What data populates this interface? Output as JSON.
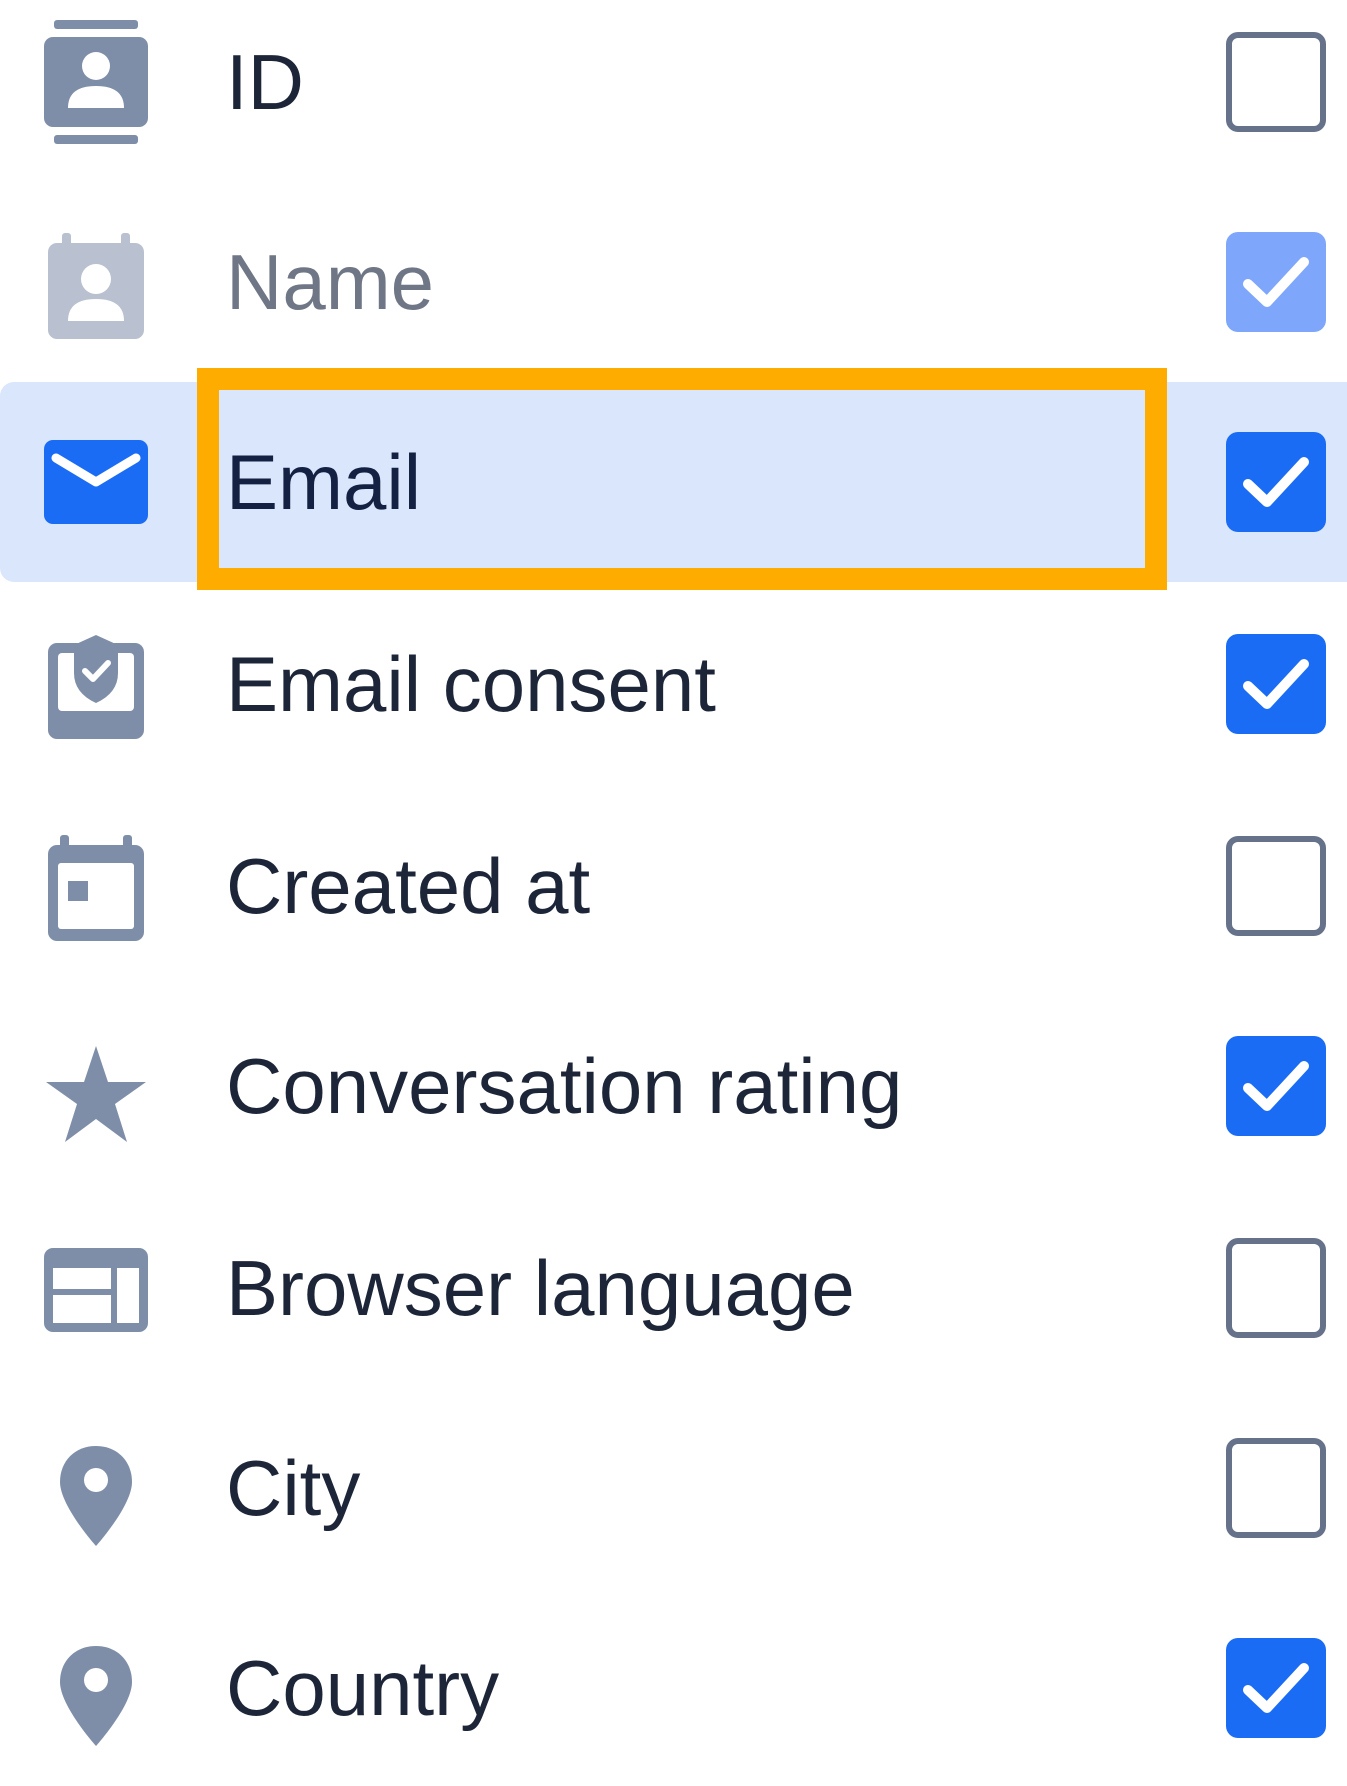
{
  "fields": [
    {
      "label": "ID",
      "icon": "contact-card-icon",
      "checked": false,
      "disabled": false
    },
    {
      "label": "Name",
      "icon": "person-badge-icon",
      "checked": true,
      "disabled": true
    },
    {
      "label": "Email",
      "icon": "envelope-icon",
      "checked": true,
      "disabled": false,
      "highlighted": true
    },
    {
      "label": "Email consent",
      "icon": "shield-check-icon",
      "checked": true,
      "disabled": false
    },
    {
      "label": "Created at",
      "icon": "calendar-icon",
      "checked": false,
      "disabled": false
    },
    {
      "label": "Conversation rating",
      "icon": "star-icon",
      "checked": true,
      "disabled": false
    },
    {
      "label": "Browser language",
      "icon": "browser-window-icon",
      "checked": false,
      "disabled": false
    },
    {
      "label": "City",
      "icon": "location-pin-icon",
      "checked": false,
      "disabled": false
    },
    {
      "label": "Country",
      "icon": "location-pin-icon",
      "checked": true,
      "disabled": false
    }
  ],
  "colors": {
    "icon_gray": "#7f8ea8",
    "icon_disabled": "#b9c0cf",
    "accent_blue": "#1a6cf5",
    "disabled_blue": "#7ea6fb",
    "highlight_bg": "#dae6fb",
    "focus_outline": "#ffac00"
  }
}
